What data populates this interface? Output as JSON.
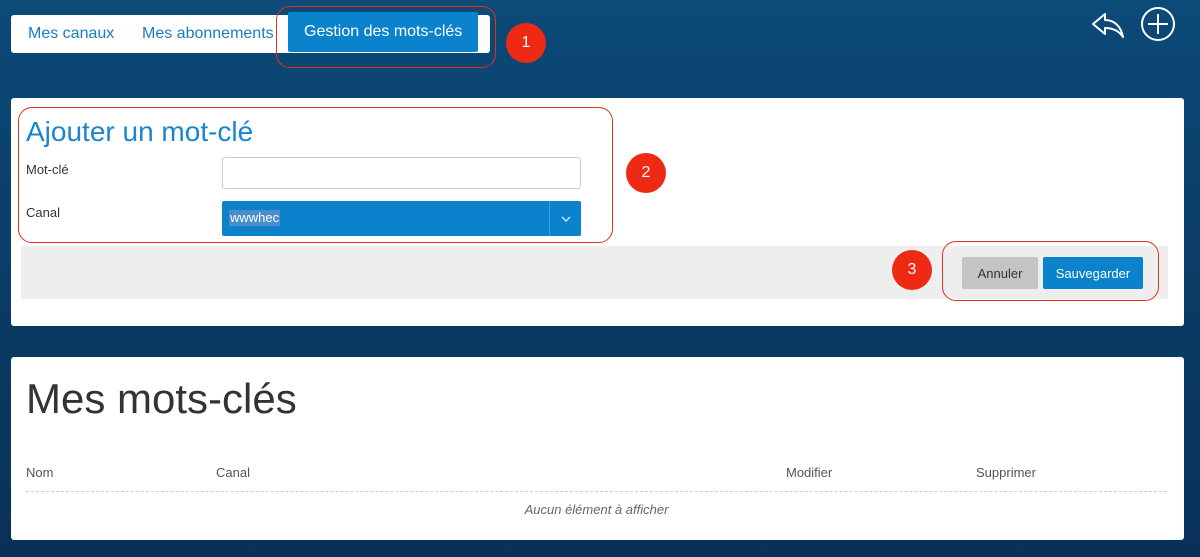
{
  "tabs": [
    {
      "label": "Mes canaux"
    },
    {
      "label": "Mes abonnements"
    },
    {
      "label": "Gestion des mots-clés"
    }
  ],
  "annotations": [
    "1",
    "2",
    "3"
  ],
  "icons": {
    "back": "reply-icon",
    "add": "plus-circle-icon"
  },
  "form": {
    "title": "Ajouter un mot-clé",
    "keyword_label": "Mot-clé",
    "keyword_value": "",
    "channel_label": "Canal",
    "channel_selected": "wwwhec"
  },
  "actions": {
    "cancel": "Annuler",
    "save": "Sauvegarder"
  },
  "list": {
    "title": "Mes mots-clés",
    "columns": [
      "Nom",
      "Canal",
      "Modifier",
      "Supprimer"
    ],
    "empty_text": "Aucun élément à afficher"
  },
  "colors": {
    "accent": "#0a83cc",
    "annotation": "#ef2a14",
    "background": "#0a3c66"
  }
}
